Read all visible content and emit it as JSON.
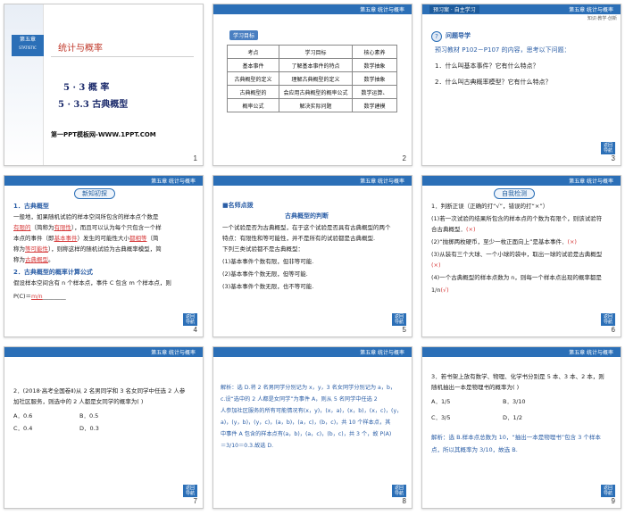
{
  "header_common": {
    "right": "第五章  统计与概率",
    "tools": "知识·教学·创新"
  },
  "back": "返回\n导航",
  "s1": {
    "badge1": "第五章",
    "badge2": "STATISTIC",
    "title": "统计与概率",
    "sec1": "5 · 3   概   率",
    "sec2": "5 · 3.3   古典概型",
    "web": "第一PPT模板网-WWW.1PPT.COM",
    "num": "1"
  },
  "s2": {
    "tag": "学习目标",
    "headers": [
      "考点",
      "学习目标",
      "核心素养"
    ],
    "rows": [
      [
        "基本事件",
        "了解基本事件的特点",
        "数学抽象"
      ],
      [
        "古典概型的定义",
        "理解古典概型的定义",
        "数学抽象"
      ],
      [
        "古典概型的",
        "会应用古典概型的概率公式",
        "数学运算、"
      ],
      [
        "概率公式",
        "解决实际问题",
        "数学建模"
      ]
    ],
    "num": "2"
  },
  "s3": {
    "tab": "预习案 · 自主学习",
    "q_title": "问题导学",
    "intro": "预习教材 P102－P107 的内容，思考以下问题：",
    "q1": "1．什么叫基本事件？它有什么特点？",
    "q2": "2．什么叫古典概率模型？它有什么特点？",
    "num": "3"
  },
  "s4": {
    "pill": "新知初探",
    "h1": "1．古典概型",
    "l1": "一般地，如果随机试验的样本空间所包含的样本点个数是",
    "l2a": "有限的",
    "l2b": "（简称为",
    "l2c": "有限性",
    "l2d": "），而且可以认为每个只包含一个样",
    "l3a": "本点的事件（即",
    "l3b": "基本事件",
    "l3c": "）发生的可能性大小",
    "l3d": "都相等",
    "l3e": "（简",
    "l4a": "称为",
    "l4b": "等可能性",
    "l4c": "），则称这样的随机试验为古典概率模型，简",
    "l5a": "称为",
    "l5b": "古典概型",
    "l5c": "。",
    "h2": "2．古典概型的概率计算公式",
    "l6": "假设样本空间含有 n 个样本点，事件 C 包含 m 个样本点，则",
    "l7a": "P(C)＝",
    "l7b": "m/n",
    "num": "4"
  },
  "s5": {
    "label": "■名师点拨",
    "title": "古典概型的判断",
    "l1": "一个试验是否为古典概型，在于这个试验是否具有古典概型的两个",
    "l2": "特点：有限性和等可能性，并不是所有的试验都是古典概型.",
    "l3": "下列三类试验都不是古典概型：",
    "l4": "(1)基本事件个数有限，但非等可能.",
    "l5": "(2)基本事件个数无限，但等可能.",
    "l6": "(3)基本事件个数无限，也不等可能.",
    "num": "5"
  },
  "s6": {
    "pill": "自我检测",
    "l1": "1．判断正误（正确的打“√”，错误的打“×”）",
    "l2": "(1)若一次试验的结果所包含的样本点的个数为有限个，则该试验符",
    "l3a": "合古典概型．",
    "l3b": "(×)",
    "l4a": "(2)“抛掷两枚硬币，至少一枚正面向上”是基本事件．",
    "l4b": "(×)",
    "l5": "(3)从装有三个大球、一个小球的袋中，取出一球的试验是古典概型",
    "l6": "(×)",
    "l7": "(4)一个古典概型的样本点数为 n，则每一个样本点出现的概率都是",
    "l8a": "1/n",
    "l8b": "(√)",
    "num": "6"
  },
  "s7": {
    "l1": "2．(2018·高考全国卷Ⅱ)从 2 名男同学和 3 名女同学中任选 2 人参",
    "l2": "加社区服务，则选中的 2 人都是女同学的概率为(    )",
    "a": "A．0.6",
    "b": "B．0.5",
    "c": "C．0.4",
    "d": "D．0.3",
    "num": "7"
  },
  "s8": {
    "l1": "解析：选 D.将 2 名男同学分别记为 x，y，3 名女同学分别记为 a，b，",
    "l2": "c.设“选中的 2 人都是女同学”为事件 A，则从 5 名同学中任选 2",
    "l3": "人参加社区服务的所有可能情况有(x，y)，(x，a)，(x，b)，(x，c)，(y，",
    "l4": "a)，(y，b)，(y，c)，(a，b)，(a，c)，(b，c)，共 10 个样本点，其",
    "l5": "中事件 A 包含的样本点有(a，b)，(a，c)，(b，c)，共 3 个，故 P(A)",
    "l6": "＝3/10＝0.3.故选 D.",
    "num": "8"
  },
  "s9": {
    "l1": "3．若书架上放有数学、物理、化学书分别是 5 本、3 本、2 本，则",
    "l2": "随机抽出一本是物理书的概率为(    )",
    "a": "A．1/5",
    "b": "B．3/10",
    "c": "C．3/5",
    "d": "D．1/2",
    "l3": "解析：选 B.样本点总数为 10，“抽出一本是物理书”包含 3 个样本",
    "l4": "点，所以其概率为 3/10，故选 B.",
    "num": "9"
  }
}
